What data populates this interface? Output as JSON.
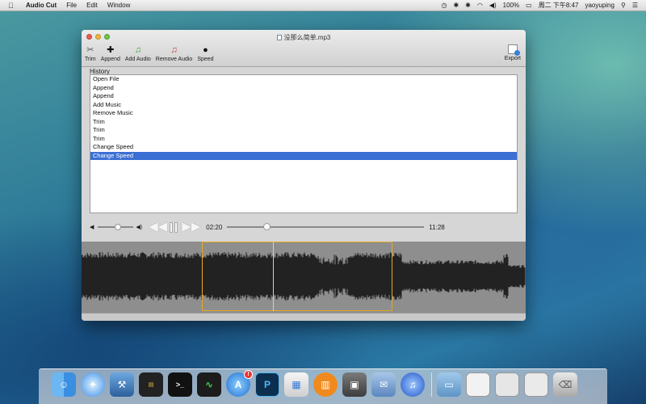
{
  "menubar": {
    "app_name": "Audio Cut",
    "menus": [
      "File",
      "Edit",
      "Window"
    ],
    "battery": "100%",
    "clock": "周二 下午8:47",
    "user": "yaoyuping"
  },
  "window": {
    "title": "没那么简单.mp3",
    "toolbar": [
      {
        "label": "Trim",
        "icon": "trim-icon",
        "glyph": "✂"
      },
      {
        "label": "Append",
        "icon": "plus-icon",
        "glyph": "✚"
      },
      {
        "label": "Add Audio",
        "icon": "add-audio-icon",
        "glyph": "♫"
      },
      {
        "label": "Remove Audio",
        "icon": "remove-audio-icon",
        "glyph": "♫"
      },
      {
        "label": "Speed",
        "icon": "snail-icon",
        "glyph": "🐌"
      }
    ],
    "export_label": "Export",
    "history_label": "History",
    "history": [
      "Open File",
      "Append",
      "Append",
      "Add Music",
      "Remove Music",
      "Trim",
      "Trim",
      "Trim",
      "Change Speed",
      "Change Speed"
    ],
    "selected_history_index": 9,
    "controls": {
      "current_time": "02:20",
      "total_time": "11:28",
      "volume_level": 0.55,
      "seek_fraction": 0.2
    },
    "waveform": {
      "selection_start_fraction": 0.27,
      "selection_end_fraction": 0.7,
      "playhead_fraction": 0.43
    }
  },
  "colors": {
    "selection_blue": "#3b6fd4",
    "selection_box": "#e5a724",
    "waveform": "#222222"
  }
}
